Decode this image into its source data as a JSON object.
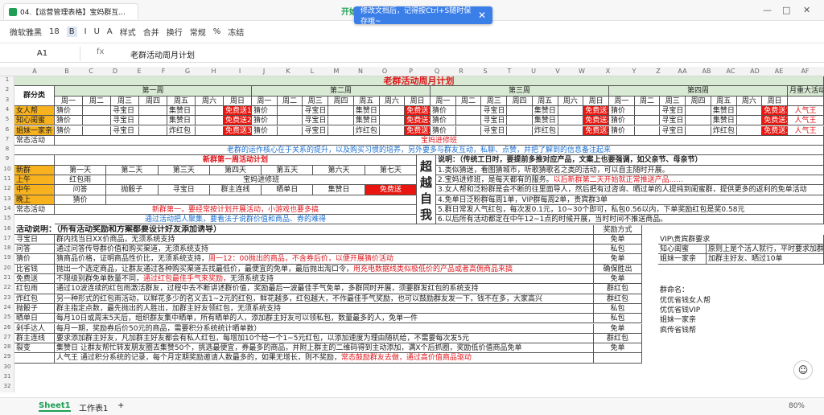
{
  "app": {
    "tab_title": "04.【运营管理表格】宝妈群互...",
    "tab_start": "开始",
    "toast": "修改文档后，记得按Ctrl+S随时保存哦~"
  },
  "toolbar": [
    "微软雅黑",
    "18",
    "B",
    "I",
    "U",
    "A",
    "样式",
    "合并",
    "换行",
    "常规",
    "%",
    "冻结"
  ],
  "formula": {
    "cell": "A1",
    "fx": "fx",
    "content": "老群活动周月计划"
  },
  "cols": [
    "A",
    "B",
    "C",
    "D",
    "E",
    "F",
    "G",
    "H",
    "I",
    "J",
    "K",
    "L",
    "M",
    "N",
    "O",
    "P",
    "Q",
    "R",
    "S",
    "T",
    "U",
    "V",
    "W",
    "X",
    "Y",
    "Z",
    "AA",
    "AB",
    "AC",
    "AD",
    "AE",
    "AF"
  ],
  "rows": [
    "1",
    "2",
    "3",
    "4",
    "5",
    "6",
    "7",
    "8",
    "9",
    "10",
    "11",
    "12",
    "13",
    "14",
    "15",
    "16",
    "17",
    "18",
    "19",
    "20",
    "21",
    "22",
    "23",
    "24",
    "25",
    "26",
    "27",
    "28",
    "29",
    "30",
    "31",
    "32"
  ],
  "sheet": {
    "title": "老群活动周月计划",
    "group_col": "群分类",
    "weeks": [
      "第一周",
      "第二周",
      "第三周",
      "第四周"
    ],
    "monthly": "月重大活动",
    "days": [
      "周一",
      "周二",
      "周三",
      "周四",
      "周五",
      "周六",
      "周日"
    ],
    "groups": [
      {
        "name": "女人帮",
        "acts": [
          "猜价",
          "寻宝日",
          "集赞日",
          "免费送1"
        ],
        "m": "人气王"
      },
      {
        "name": "知心闺蜜",
        "acts": [
          "猜价",
          "寻宝日",
          "集赞日",
          "免费送2"
        ],
        "m": "人气王"
      },
      {
        "name": "姐妹一家亲",
        "acts": [
          "猜价",
          "寻宝日",
          "炸红包",
          "免费送3"
        ],
        "m": "人气王"
      }
    ],
    "row6_label": "常态活动",
    "row6_val": "宝妈进修班",
    "row7": "老群的运作核心在于关系的提升，以及购买习惯的培养，另外要多与群友互动，私聊、点赞，并把了解到的信息备注起来",
    "nf_title": "新群第一周活动计划",
    "nf_days": [
      "第一天",
      "第二天",
      "第三天",
      "第四天",
      "第五天",
      "第六天",
      "第七天"
    ],
    "nf_rows": [
      {
        "label": "新群",
        "cells": []
      },
      {
        "label": "上午",
        "cells": [
          "红包雨",
          "宝妈进修班"
        ]
      },
      {
        "label": "中午",
        "cells": [
          "问答",
          "抛骰子",
          "寻宝日",
          "群主连线",
          "晒单日",
          "集赞日",
          "免费送"
        ]
      },
      {
        "label": "晚上",
        "cells": [
          "猜价"
        ]
      }
    ],
    "nf_note1": "新群第一，要经常按计划开展活动，小游戏也要多搞",
    "nf_note2": "通过活动把人聚集，要看法子说群价值和商品、券的难得",
    "nf_normal": "常态活动",
    "chao": [
      "超",
      "越",
      "自",
      "我"
    ],
    "notes_title": "说明：（传统工日时，要提前多推对应产品，文案上也要强调，如父亲节、母亲节）",
    "notes": [
      "1.类似猜迷，看图猜城市，听歌猜歌名之类的活动，可以自主随时开展。",
      "2.宝妈进修班，是每天都有的服务。",
      "3.女人帮和泛粉群是会不断的往里面导人，然后把有过咨询、晒过单的人提纯到闺蜜群，提供更多的返利的免单活动",
      "4.免单日泛粉群每周1单，VIP群每周2单，贵宾群3单",
      "5.群日常发人气红包，每次发0.1元，10~30个即可，私包0.56以内，下单奖励红包是奖0.58元",
      "6.以后所有活动都定在中午12~1点的时候开展，当时时间不推送商品。"
    ],
    "notes_red2": "以后新群第二天开始就正常推送产品......",
    "act_title": "活动说明：（所有活动奖励和方案都要设计好友添加诱导）",
    "reward_hdr": "奖励方式",
    "acts": [
      {
        "n": "寻宝日",
        "d": "群内找当日XX价商品，无须系统支持",
        "r": "免单"
      },
      {
        "n": "问答",
        "d": "通过问答传导群价值和购买渠道，无须系统支持",
        "r": "私包"
      },
      {
        "n": "猜价",
        "d": "猜商品价格，证明商品性价比，无须系统支持，",
        "dr": "周一12：00抛出的商品，不含券后价，以便开展猜价活动",
        "r": "免单"
      },
      {
        "n": "比省钱",
        "d": "抛出一个选定商品，让群友通过各种购买渠道去找最低价，最便宜的免单，最后抛出淘口令，",
        "dr": "用充电数据线类似极低价的产品或者高佣商品来搞",
        "r": "确保胜出"
      },
      {
        "n": "免费送",
        "d": "不限级别群免单数量不同，",
        "dr": "通过红包最佳手气来奖励，",
        "d2": "无须系统支持",
        "r": "免单"
      },
      {
        "n": "红包雨",
        "d": "通过10波连续的红包雨激活群友，过程中去不断讲述群价值，奖励最后一波最佳手气免单，多群同时开展，须要群发红包的系统支持",
        "r": "群红包"
      },
      {
        "n": "炸红包",
        "d": "另一种形式的红包雨活动，以鲜花多少的名义去1~2元的红包，鲜花越多，红包越大，不作最佳手气奖励，也可以鼓励群友发一下，钱不在多，大家高兴",
        "r": "群红包"
      },
      {
        "n": "抛骰子",
        "d": "群主指定点数，最先抛出的人胜出，加群主好友领红包，无须系统支持",
        "r": "私包"
      },
      {
        "n": "晒单日",
        "d": "每月10日或周末5天后，组织群友集中晒单，所有晒单的人，添加群主好友可以领私包，数量最多的人，免单一件",
        "r": "私包"
      },
      {
        "n": "剁手达人",
        "d": "每月一期，奖励券后价50元的商品，需要积分系统统计晒单数）",
        "r": "免单"
      },
      {
        "n": "群主连线",
        "d": "要求添加群主好友，凡加群主好友都会有私人红包，每增加10个给一个1~5元红包，以添加速度为理由随机给，不需要每次发5元",
        "r": "群红包"
      },
      {
        "n": "裂变",
        "d": "集赞日  让群友帮忙转发朋友圈去集赞50个，挑选最便宜，券最多的商品，并附上群主的二维码得到主动添加，满X个后抓圈，奖励低价值商品免单",
        "r": "免单"
      },
      {
        "n": "",
        "d": "人气王  通过积分系统的记录，每个月定期奖励邀请人数最多的，如果无增长，则不奖励，",
        "dr": "常态鼓励群友去做，通过高价值商品驱动",
        "r": ""
      }
    ],
    "vip": [
      "VIP\\贵宾群要求",
      "知心闺蜜",
      "原则上是个活人就行，平时要求加群",
      "姐妹一家亲",
      "加群主好友、晒过10单"
    ],
    "groupnames_title": "群命名：",
    "groupnames": [
      "优优省钱女人帮",
      "优优省钱VIP",
      "姐妹一家亲",
      "疯传省钱帮"
    ]
  },
  "sheets": [
    "Sheet1",
    "工作表1"
  ],
  "zoom": "80%"
}
